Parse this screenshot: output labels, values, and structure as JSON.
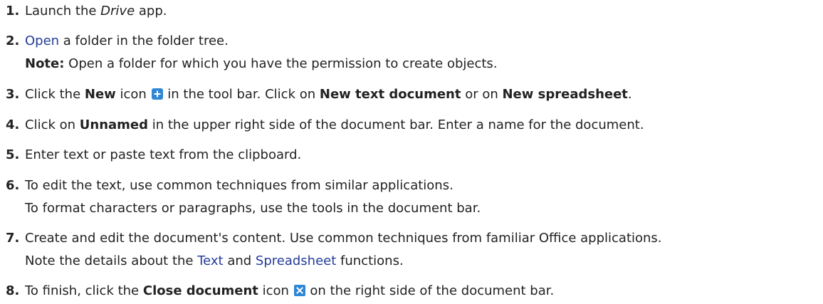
{
  "steps": [
    {
      "number": "1.",
      "parts": {
        "a": "Launch the ",
        "drive": "Drive",
        "b": " app."
      }
    },
    {
      "number": "2.",
      "parts": {
        "open_link": "Open",
        "a": " a folder in the folder tree.",
        "note_label": "Note:",
        "note_text": " Open a folder for which you have the permission to create objects."
      }
    },
    {
      "number": "3.",
      "parts": {
        "a": "Click the ",
        "new": "New",
        "b": " icon ",
        "c": " in the tool bar. Click on ",
        "new_text_doc": "New text document",
        "d": " or on ",
        "new_spreadsheet": "New spreadsheet",
        "e": "."
      }
    },
    {
      "number": "4.",
      "parts": {
        "a": "Click on ",
        "unnamed": "Unnamed",
        "b": " in the upper right side of the document bar. Enter a name for the document."
      }
    },
    {
      "number": "5.",
      "parts": {
        "a": "Enter text or paste text from the clipboard."
      }
    },
    {
      "number": "6.",
      "parts": {
        "line1": "To edit the text, use common techniques from similar applications.",
        "line2": "To format characters or paragraphs, use the tools in the document bar."
      }
    },
    {
      "number": "7.",
      "parts": {
        "line1": "Create and edit the document's content. Use common techniques from familiar Office applications.",
        "a": "Note the details about the ",
        "text_link": "Text",
        "b": " and ",
        "spreadsheet_link": "Spreadsheet",
        "c": " functions."
      }
    },
    {
      "number": "8.",
      "parts": {
        "a": "To finish, click the ",
        "close_doc": "Close document",
        "b": " icon ",
        "c": " on the right side of the document bar."
      }
    }
  ],
  "icons": {
    "new": {
      "name": "plus-square-icon",
      "color": "#2f86d4"
    },
    "close": {
      "name": "close-square-icon",
      "color": "#2f86d4"
    }
  },
  "colors": {
    "text": "#222222",
    "link": "#243c9a"
  }
}
